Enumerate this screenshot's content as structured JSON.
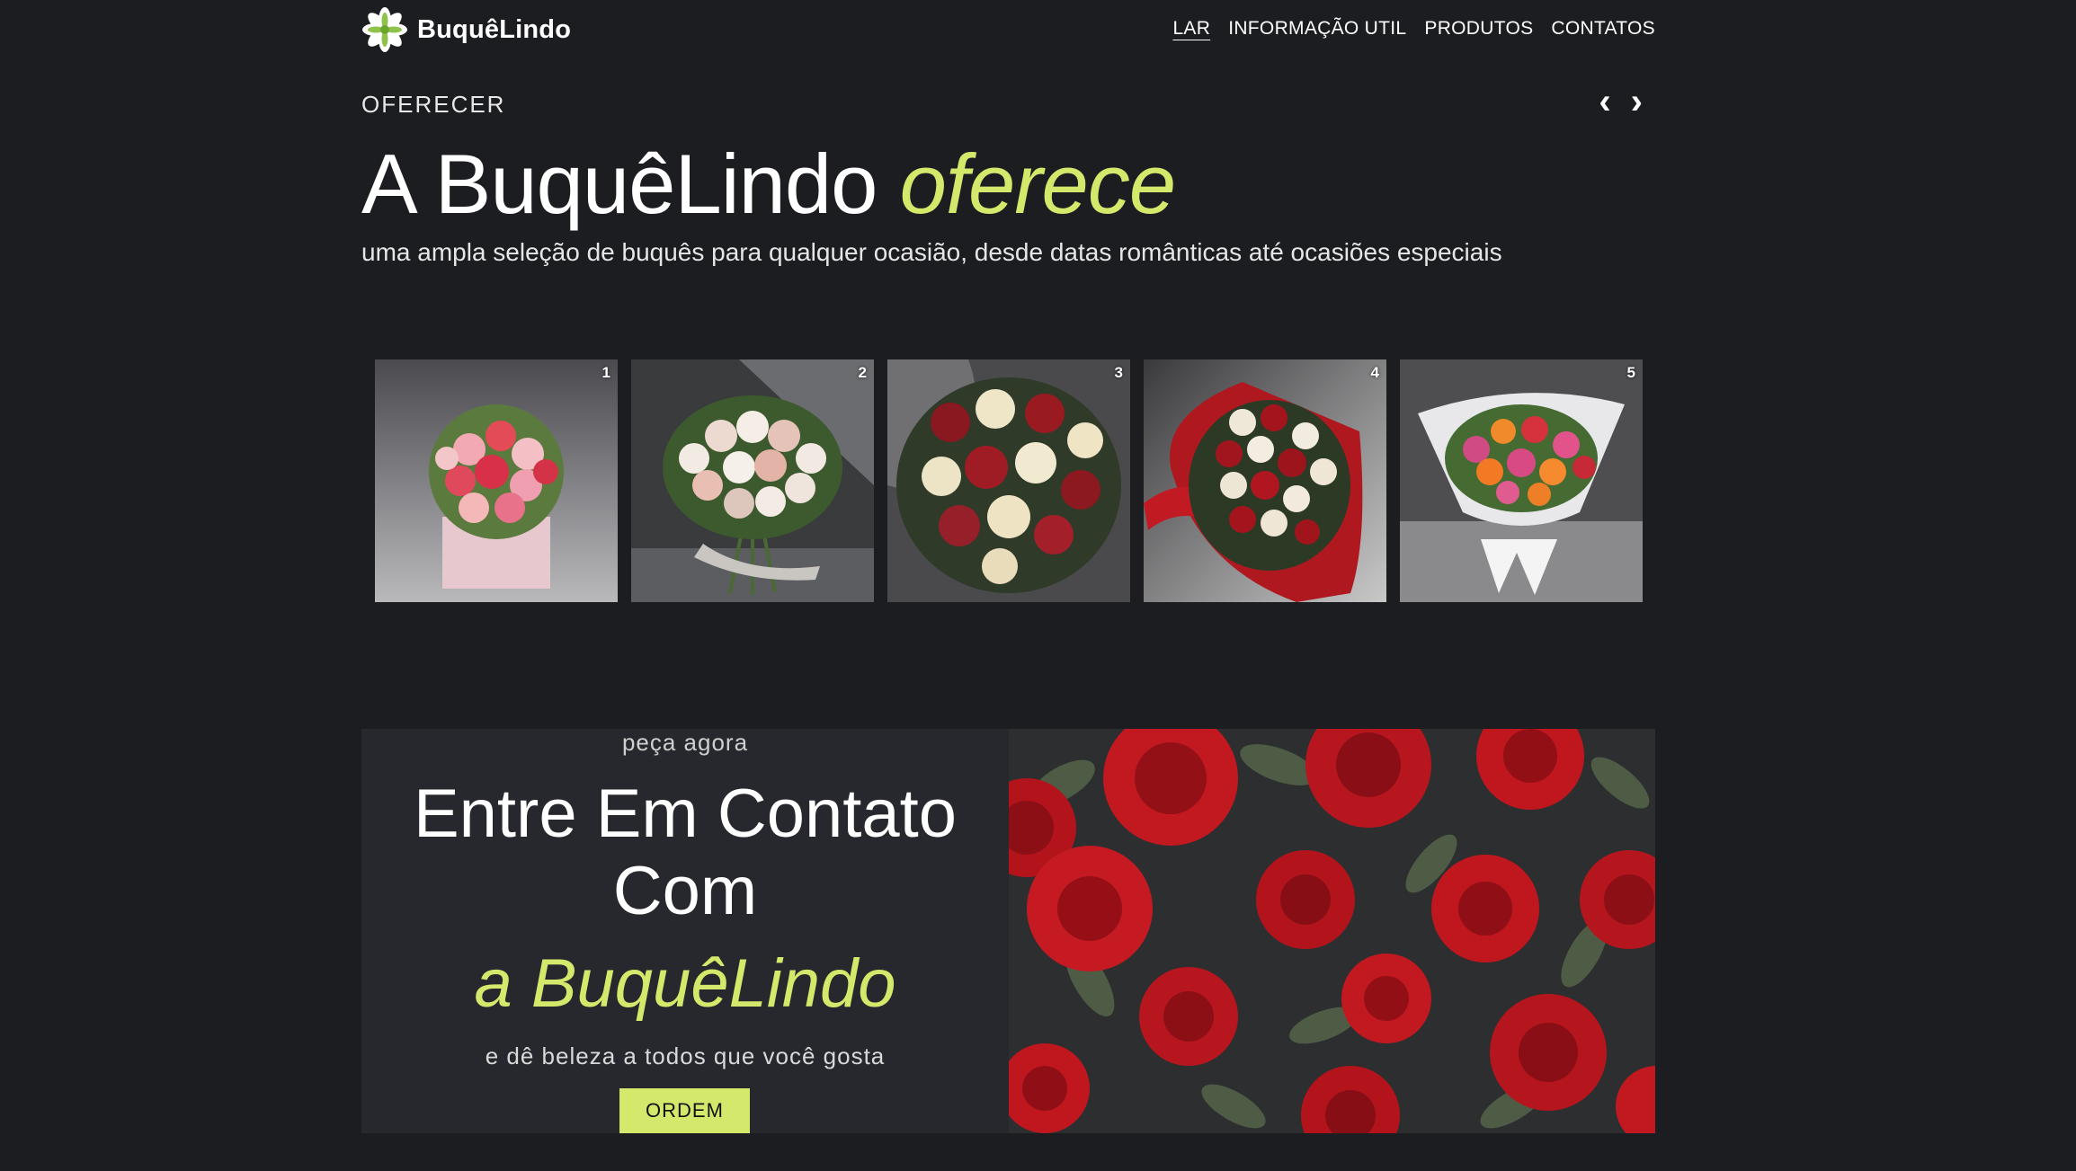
{
  "header": {
    "brand": "BuquêLindo",
    "nav": [
      {
        "label": "LAR",
        "active": true
      },
      {
        "label": "INFORMAÇÃO UTIL"
      },
      {
        "label": "PRODUTOS"
      },
      {
        "label": "CONTATOS"
      }
    ]
  },
  "hero": {
    "kicker": "OFERECER",
    "title_main": "A BuquêLindo",
    "title_accent": "oferece",
    "subtitle": "uma ampla seleção de buquês para qualquer ocasião, desde datas românticas até ocasiões especiais",
    "prev_icon": "‹",
    "next_icon": "›"
  },
  "gallery": {
    "items": [
      {
        "number": "1"
      },
      {
        "number": "2"
      },
      {
        "number": "3"
      },
      {
        "number": "4"
      },
      {
        "number": "5"
      }
    ]
  },
  "contact": {
    "kicker": "peça agora",
    "title_line1": "Entre Em Contato",
    "title_line2": "Com",
    "brand": "a BuquêLindo",
    "subtitle": "e dê beleza a todos que você gosta",
    "button": "ORDEM"
  },
  "colors": {
    "background": "#1c1d21",
    "accent": "#d4e86b",
    "panel": "#26282d"
  }
}
